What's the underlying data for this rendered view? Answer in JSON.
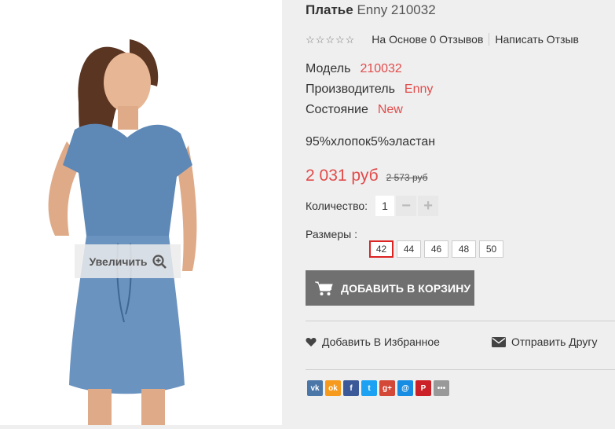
{
  "product": {
    "title_name": "Платье",
    "title_code": "Enny 210032",
    "zoom_label": "Увеличить",
    "rating": {
      "stars_filled": 0,
      "stars_total": 5,
      "reviews_text": "На Основе 0 Отзывов",
      "write_review": "Написать Отзыв"
    },
    "attributes": [
      {
        "label": "Модель",
        "value": "210032"
      },
      {
        "label": "Производитель",
        "value": "Enny"
      },
      {
        "label": "Состояние",
        "value": "New"
      }
    ],
    "composition": "95%хлопок5%эластан",
    "price": {
      "current": "2 031 руб",
      "old": "2 573 руб"
    },
    "quantity": {
      "label": "Количество:",
      "value": "1",
      "minus": "−",
      "plus": "+"
    },
    "sizes": {
      "label": "Размеры :",
      "options": [
        "42",
        "44",
        "46",
        "48",
        "50"
      ],
      "selected": "42"
    },
    "add_to_cart": "ДОБАВИТЬ В КОРЗИНУ",
    "wishlist": "Добавить В Избранное",
    "send_friend": "Отправить Другу"
  },
  "share": [
    {
      "icon": "vk-icon",
      "glyph": "vk",
      "color": "#4a76a8"
    },
    {
      "icon": "odnoklassniki-icon",
      "glyph": "ok",
      "color": "#f59a1d"
    },
    {
      "icon": "facebook-icon",
      "glyph": "f",
      "color": "#3b5998"
    },
    {
      "icon": "twitter-icon",
      "glyph": "t",
      "color": "#1da1f2"
    },
    {
      "icon": "google-plus-icon",
      "glyph": "g+",
      "color": "#d34836"
    },
    {
      "icon": "mail-icon",
      "glyph": "@",
      "color": "#168de2"
    },
    {
      "icon": "pinterest-icon",
      "glyph": "P",
      "color": "#cb2027"
    },
    {
      "icon": "more-icon",
      "glyph": "•••",
      "color": "#999999"
    }
  ],
  "colors": {
    "accent": "#e24b4b",
    "button": "#707070",
    "selected_size_border": "#dd2222"
  }
}
